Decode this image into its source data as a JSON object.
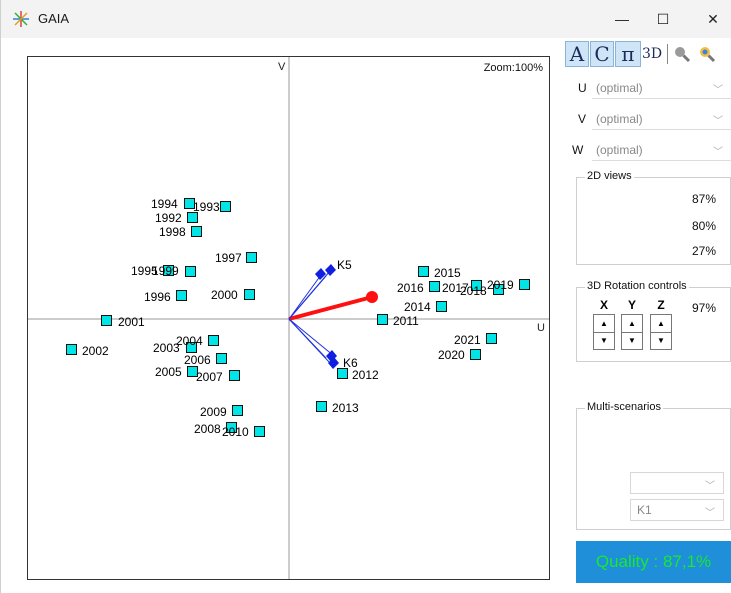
{
  "window": {
    "title": "GAIA",
    "minimize": "—",
    "maximize": "☐",
    "close": "✕"
  },
  "plot": {
    "axis_v": "V",
    "axis_u": "U",
    "zoom": "Zoom:100%"
  },
  "points": [
    {
      "label": "1994"
    },
    {
      "label": "1993"
    },
    {
      "label": "1992"
    },
    {
      "label": "1998"
    },
    {
      "label": "1997"
    },
    {
      "label": "1995"
    },
    {
      "label": "1999"
    },
    {
      "label": "1996"
    },
    {
      "label": "2000"
    },
    {
      "label": "2001"
    },
    {
      "label": "2002"
    },
    {
      "label": "2003"
    },
    {
      "label": "2004"
    },
    {
      "label": "2005"
    },
    {
      "label": "2006"
    },
    {
      "label": "2007"
    },
    {
      "label": "2009"
    },
    {
      "label": "2008"
    },
    {
      "label": "2010"
    },
    {
      "label": "2011"
    },
    {
      "label": "2012"
    },
    {
      "label": "2013"
    },
    {
      "label": "2014"
    },
    {
      "label": "2015"
    },
    {
      "label": "2016"
    },
    {
      "label": "2017"
    },
    {
      "label": "2018"
    },
    {
      "label": "2019"
    },
    {
      "label": "2020"
    },
    {
      "label": "2021"
    }
  ],
  "criteria": [
    {
      "label": "K5"
    },
    {
      "label": "K6"
    }
  ],
  "toolbar": {
    "a": "A",
    "c": "C",
    "pi": "π",
    "three_d": "3D"
  },
  "axes_select": {
    "u_label": "U",
    "u_value": "(optimal)",
    "v_label": "V",
    "v_value": "(optimal)",
    "w_label": "W",
    "w_value": "(optimal)"
  },
  "views_2d": {
    "title": "2D views",
    "values": [
      "87%",
      "80%",
      "27%"
    ]
  },
  "rotation": {
    "title": "3D Rotation controls",
    "x": "X",
    "y": "Y",
    "z": "Z",
    "value": "97%"
  },
  "multi": {
    "title": "Multi-scenarios",
    "select1": "",
    "select2": "K1"
  },
  "quality": "Quality : 87,1%"
}
